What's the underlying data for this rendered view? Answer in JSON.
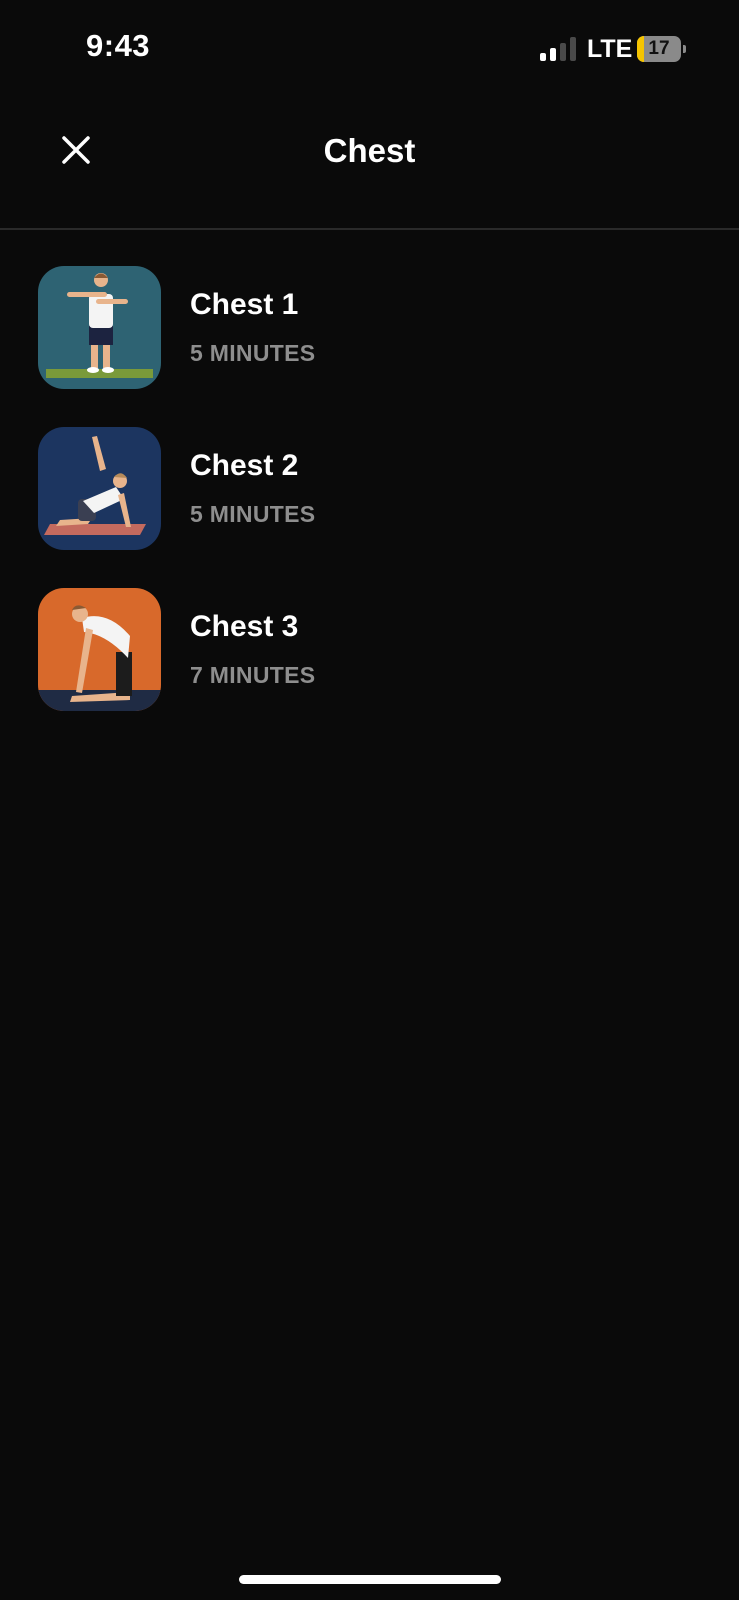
{
  "status_bar": {
    "time": "9:43",
    "network": "LTE",
    "battery_level": "17",
    "battery_fraction": 0.17,
    "signal_bars_active": 2,
    "signal_bars_total": 4
  },
  "header": {
    "title": "Chest",
    "close_icon": "close-icon"
  },
  "workouts": [
    {
      "title": "Chest 1",
      "duration": "5 MINUTES",
      "thumbnail_color": "#2e6373",
      "icon": "standing-arm-stretch-illustration"
    },
    {
      "title": "Chest 2",
      "duration": "5 MINUTES",
      "thumbnail_color": "#1c3560",
      "icon": "kneeling-twist-stretch-illustration"
    },
    {
      "title": "Chest 3",
      "duration": "7 MINUTES",
      "thumbnail_color": "#d8692b",
      "icon": "camel-pose-illustration"
    }
  ],
  "colors": {
    "background": "#0a0a0a",
    "text_primary": "#ffffff",
    "text_secondary": "#8e8e8e",
    "divider": "#2a2a2a",
    "battery_fill": "#f5c400"
  }
}
